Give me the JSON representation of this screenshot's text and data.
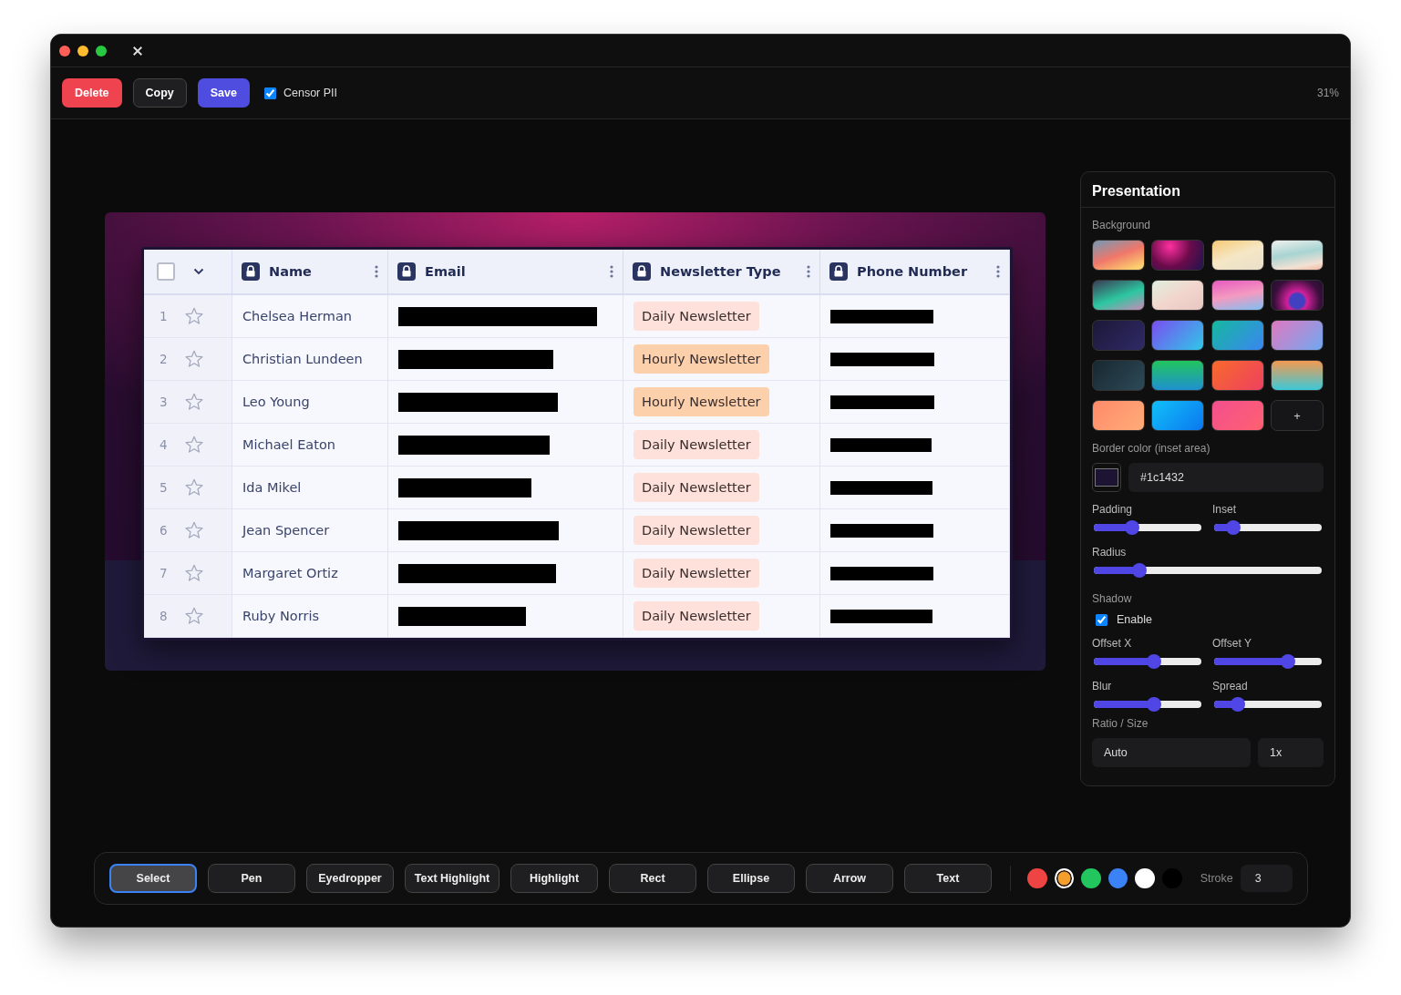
{
  "toolbar": {
    "buttons": [
      {
        "label": "Delete",
        "kind": "danger"
      },
      {
        "label": "Copy",
        "kind": "secondary"
      },
      {
        "label": "Save",
        "kind": "primary"
      }
    ],
    "censor_pii": {
      "label": "Censor PII",
      "checked": true
    },
    "zoom": "31%"
  },
  "table": {
    "select_all_checked": false,
    "columns": [
      "Name",
      "Email",
      "Newsletter Type",
      "Phone Number"
    ],
    "rows": [
      {
        "index": "1",
        "starred": false,
        "name": "Chelsea Herman",
        "newsletter_type": "Daily Newsletter",
        "color": "#fde1da"
      },
      {
        "index": "2",
        "starred": false,
        "name": "Christian Lundeen",
        "newsletter_type": "Hourly Newsletter",
        "color": "#fdd0ac"
      },
      {
        "index": "3",
        "starred": false,
        "name": "Leo Young",
        "newsletter_type": "Hourly Newsletter",
        "color": "#fdd0ac"
      },
      {
        "index": "4",
        "starred": false,
        "name": "Michael Eaton",
        "newsletter_type": "Daily Newsletter",
        "color": "#fde1da"
      },
      {
        "index": "5",
        "starred": false,
        "name": "Ida Mikel",
        "newsletter_type": "Daily Newsletter",
        "color": "#fde1da"
      },
      {
        "index": "6",
        "starred": false,
        "name": "Jean Spencer",
        "newsletter_type": "Daily Newsletter",
        "color": "#fde1da"
      },
      {
        "index": "7",
        "starred": false,
        "name": "Margaret Ortiz",
        "newsletter_type": "Daily Newsletter",
        "color": "#fde1da"
      },
      {
        "index": "8",
        "starred": false,
        "name": "Ruby Norris",
        "newsletter_type": "Daily Newsletter",
        "color": "#fde1da"
      }
    ]
  },
  "panel": {
    "title": "Presentation",
    "background_label": "Background",
    "add_label": "+",
    "border_label": "Border color (inset area)",
    "border_value": "#1c1432",
    "slider_rows": [
      [
        {
          "label": "Padding",
          "level": 0.3
        },
        {
          "label": "Inset",
          "level": 0.12
        }
      ],
      [
        {
          "label": "Radius",
          "level": 0.17
        }
      ]
    ],
    "shadow": {
      "label": "Shadow",
      "enable_label": "Enable",
      "checked": true
    },
    "shadow_rows": [
      [
        {
          "label": "Offset X",
          "level": 0.5
        },
        {
          "label": "Offset Y",
          "level": 0.63
        }
      ],
      [
        {
          "label": "Blur",
          "level": 0.5
        },
        {
          "label": "Spread",
          "level": 0.16
        }
      ]
    ],
    "ratio_label": "Ratio / Size",
    "ratio_value": "Auto",
    "size_value": "1x"
  },
  "tools": [
    {
      "label": "Select",
      "selected": true
    },
    {
      "label": "Pen",
      "selected": false
    },
    {
      "label": "Eyedropper",
      "selected": false
    },
    {
      "label": "Text Highlight",
      "selected": false
    },
    {
      "label": "Highlight",
      "selected": false
    },
    {
      "label": "Rect",
      "selected": false
    },
    {
      "label": "Ellipse",
      "selected": false
    },
    {
      "label": "Arrow",
      "selected": false
    },
    {
      "label": "Text",
      "selected": false
    }
  ],
  "colors": [
    {
      "color": "#ef4444",
      "selected": false
    },
    {
      "color": "#f59e2b",
      "selected": true
    },
    {
      "color": "#22c55e",
      "selected": false
    },
    {
      "color": "#3b82f6",
      "selected": false
    },
    {
      "color": "#ffffff",
      "selected": false
    },
    {
      "color": "#000000",
      "selected": false
    }
  ],
  "stroke": {
    "label": "Stroke",
    "value": "3"
  }
}
